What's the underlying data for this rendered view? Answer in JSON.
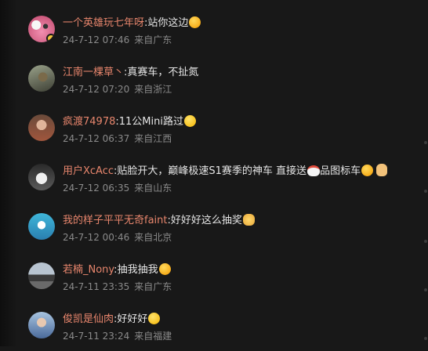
{
  "colors": {
    "background": "#181818",
    "username": "#e8866d",
    "meta": "#8a8a8a",
    "text": "#e6e6e6"
  },
  "comments": [
    {
      "user": "一个英雄玩七年呀",
      "text": "站你这边",
      "emoji": "shocked-face-emoji",
      "date": "24-7-12 07:46",
      "location": "来自广东",
      "avatar": "pink-cartoon-avatar"
    },
    {
      "user": "江南一棵草丶",
      "text": "真赛车，不扯氮",
      "emoji": "",
      "date": "24-7-12 07:20",
      "location": "来自浙江",
      "avatar": "bird-photo-avatar"
    },
    {
      "user": "疯渡74978",
      "text": "11公Mini路过",
      "emoji": "grimace-face-emoji",
      "date": "24-7-12 06:37",
      "location": "来自江西",
      "avatar": "person-photo-avatar"
    },
    {
      "user": "用户XcAcc",
      "text": "贴脸开大，巅峰极速S1赛季的神车 直接送",
      "emoji": "chicken-emoji",
      "text2": "品图标车",
      "emoji2": "heart-eyes-emoji",
      "emoji3": "ok-hand-emoji",
      "date": "24-7-12 06:35",
      "location": "来自山东",
      "avatar": "anime-girl-avatar"
    },
    {
      "user": "我的样子平平无奇faint",
      "text": "好好好这么抽奖",
      "emoji": "cat-face-emoji",
      "date": "24-7-12 00:46",
      "location": "来自北京",
      "avatar": "blue-cartoon-avatar"
    },
    {
      "user": "若楠_Nony",
      "text": "抽我抽我",
      "emoji": "heart-face-emoji",
      "date": "24-7-11 23:35",
      "location": "来自广东",
      "avatar": "car-photo-avatar"
    },
    {
      "user": "俊凯是仙肉",
      "text": "好好好",
      "emoji": "laughing-face-emoji",
      "date": "24-7-11 23:24",
      "location": "来自福建",
      "avatar": "person-blue-avatar"
    }
  ]
}
